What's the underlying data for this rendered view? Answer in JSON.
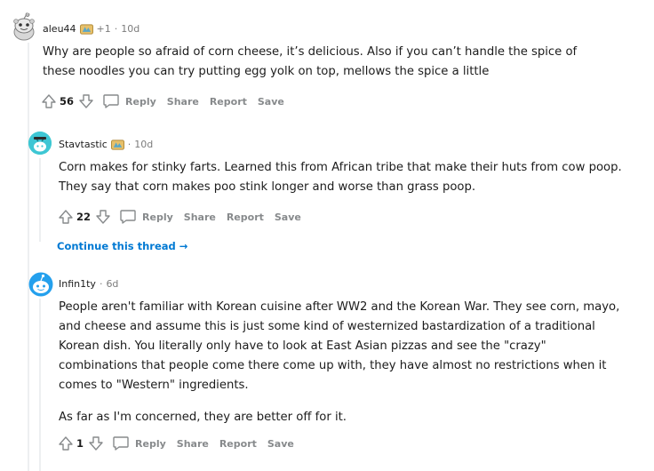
{
  "comments": [
    {
      "username": "aleu44",
      "flair_count": "+1",
      "time": "10d",
      "paragraphs": [
        "Why are people so afraid of corn cheese, it’s delicious. Also if you can’t handle the spice of these noodles you can try putting egg yolk on top, mellows the spice a little"
      ],
      "score": "56"
    },
    {
      "username": "Stavtastic",
      "time": "10d",
      "paragraphs": [
        "Corn makes for stinky farts. Learned this from African tribe that make their huts from cow poop. They say that corn makes poo stink longer and worse than grass poop."
      ],
      "score": "22",
      "continue_label": "Continue this thread →"
    },
    {
      "username": "Infin1ty",
      "time": "6d",
      "paragraphs": [
        "People aren't familiar with Korean cuisine after WW2 and the Korean War. They see corn, mayo, and cheese and assume this is just some kind of westernized bastardization of a traditional Korean dish. You literally only have to look at East Asian pizzas and see the \"crazy\" combinations that people come there come up with, they have almost no restrictions when it comes to \"Western\" ingredients.",
        "As far as I'm concerned, they are better off for it."
      ],
      "score": "1"
    }
  ],
  "actions": {
    "reply": "Reply",
    "share": "Share",
    "report": "Report",
    "save": "Save"
  },
  "separator": "·",
  "colors": {
    "thread_line": "#edeff1",
    "link": "#0079d3",
    "muted": "#878a8c"
  }
}
